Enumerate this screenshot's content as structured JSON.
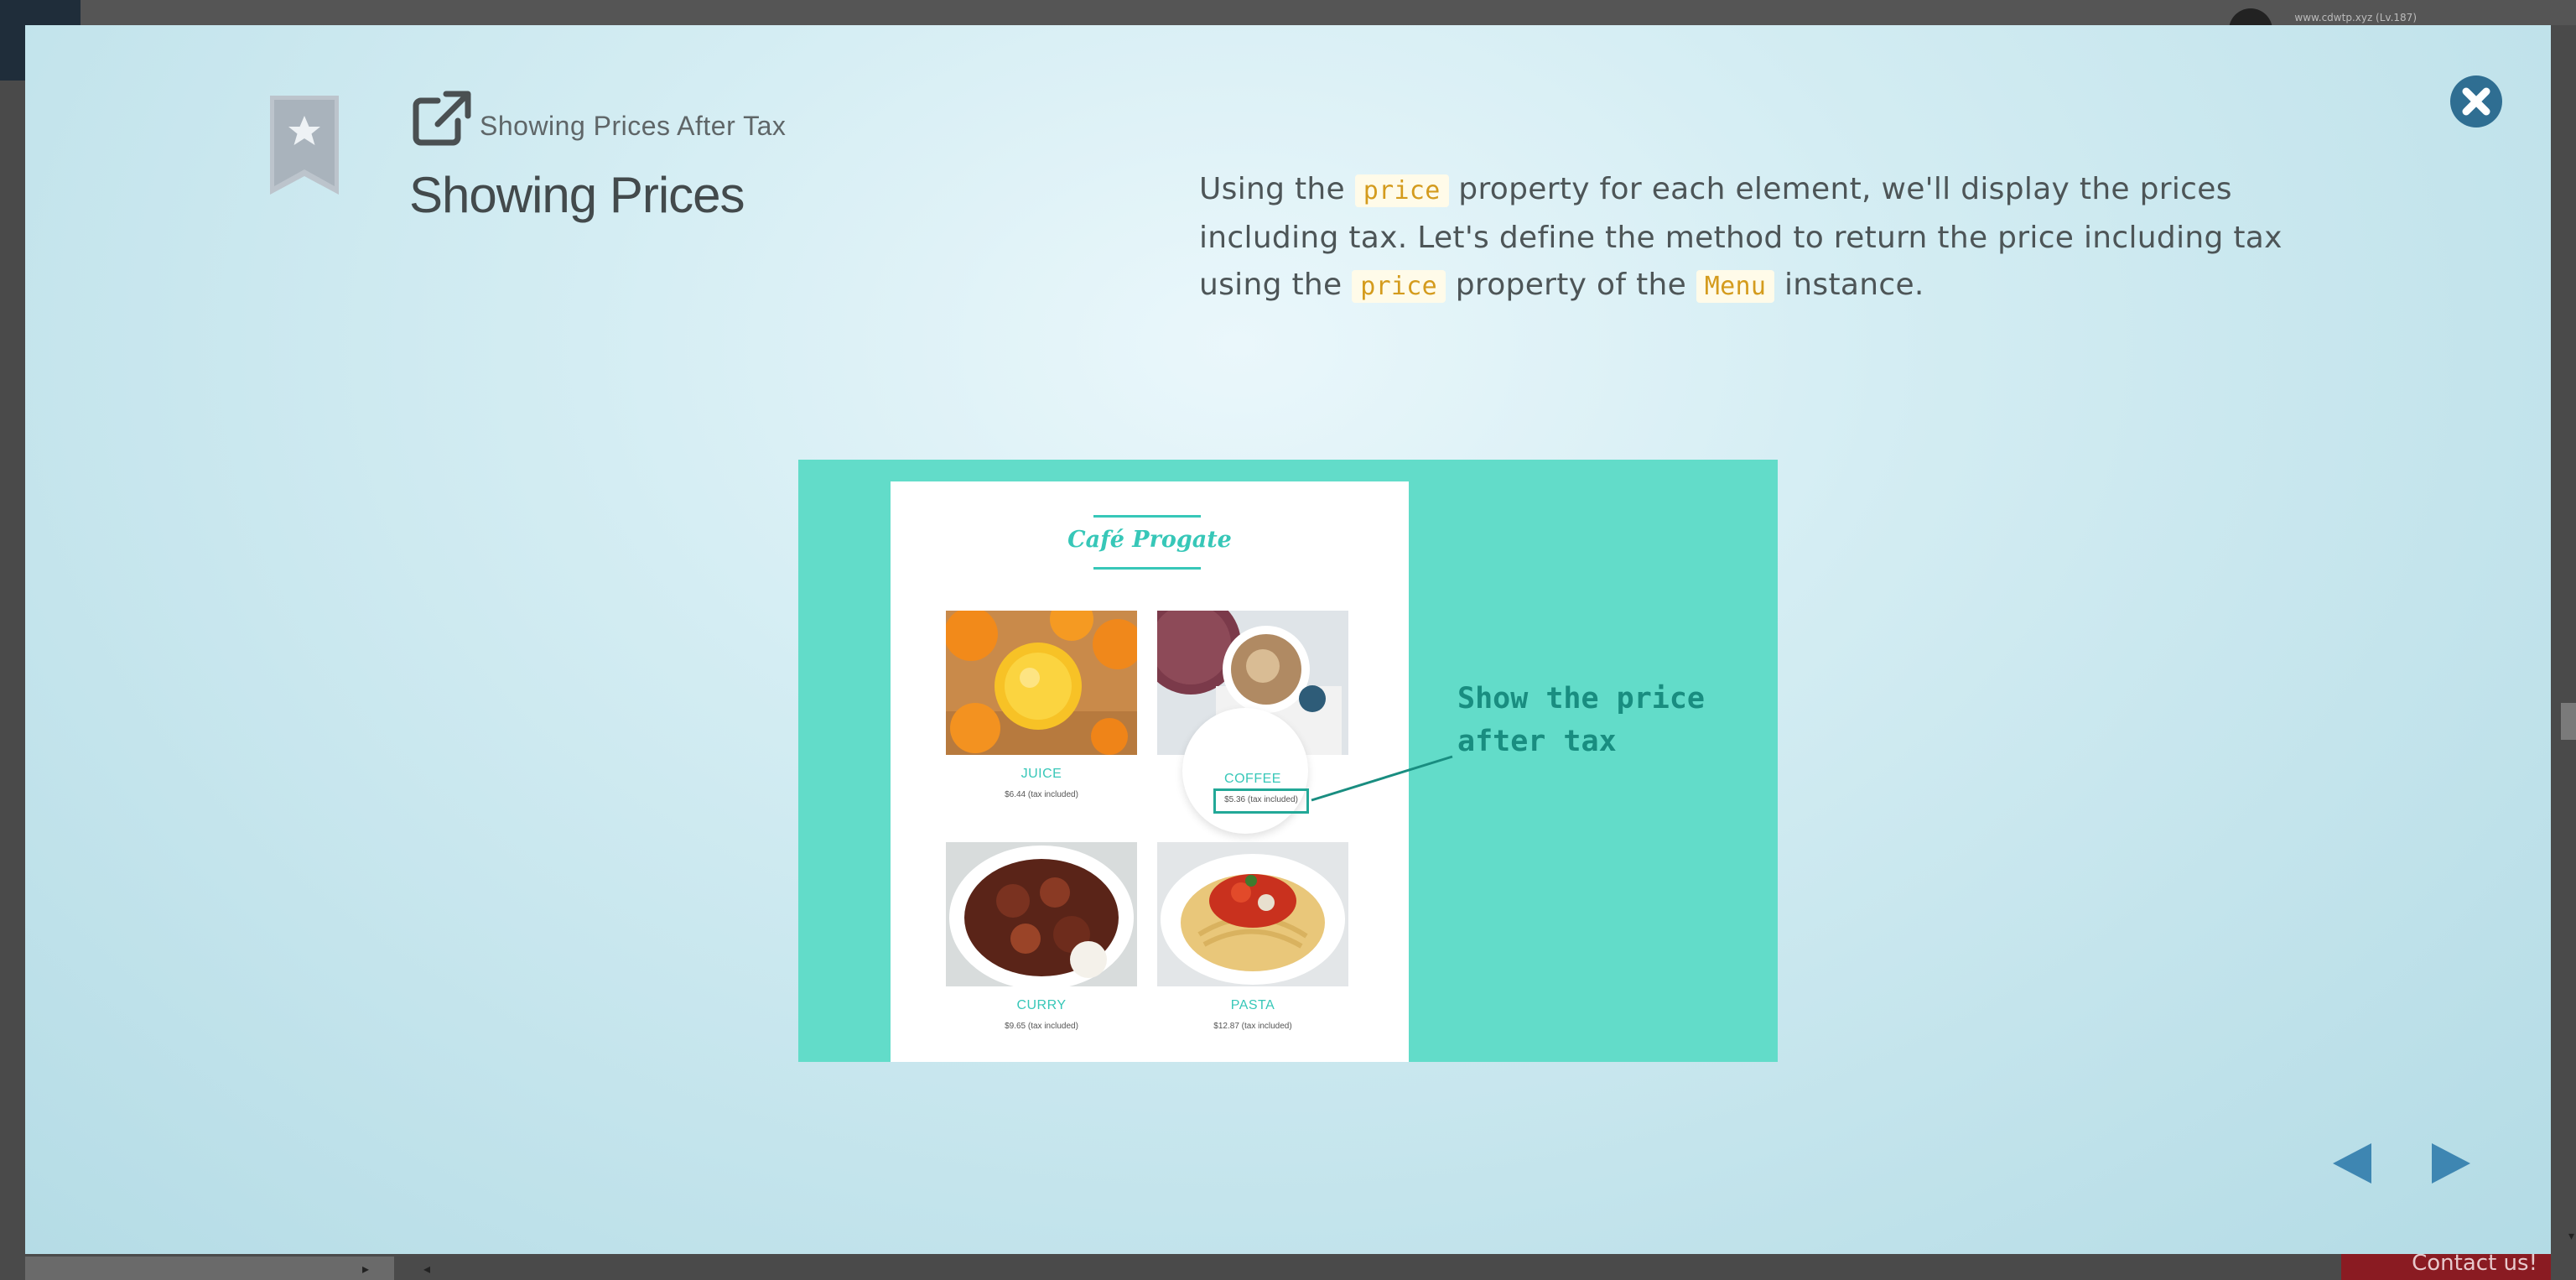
{
  "background": {
    "user_line": "www.cdwtp.xyz (Lv.187)",
    "contact_label": "Contact us!"
  },
  "modal": {
    "subtitle": "Showing Prices After Tax",
    "title": "Showing Prices",
    "description": {
      "t1": "Using the ",
      "c1": "price",
      "t2": " property for each element, we'll display the prices including tax. Let's define the method to return the price including tax using the ",
      "c2": "price",
      "t3": " property of the ",
      "c3": "Menu",
      "t4": " instance."
    },
    "colors": {
      "accent": "#2f6e92",
      "code_text": "#d49b1d",
      "slide_bg": "#62dcc9"
    }
  },
  "illustration": {
    "cafe_name": "Café Progate",
    "items": [
      {
        "name": "JUICE",
        "price": "$6.44 (tax included)",
        "icon": "juice-photo"
      },
      {
        "name": "COFFEE",
        "price": "$5.36 (tax included)",
        "icon": "coffee-photo"
      },
      {
        "name": "CURRY",
        "price": "$9.65 (tax included)",
        "icon": "curry-photo"
      },
      {
        "name": "PASTA",
        "price": "$12.87 (tax included)",
        "icon": "pasta-photo"
      }
    ],
    "annotation": "Show the price\nafter tax"
  },
  "icons": {
    "bookmark": "bookmark-star-icon",
    "external": "external-link-icon",
    "close": "close-icon",
    "prev": "triangle-left-icon",
    "next": "triangle-right-icon"
  }
}
